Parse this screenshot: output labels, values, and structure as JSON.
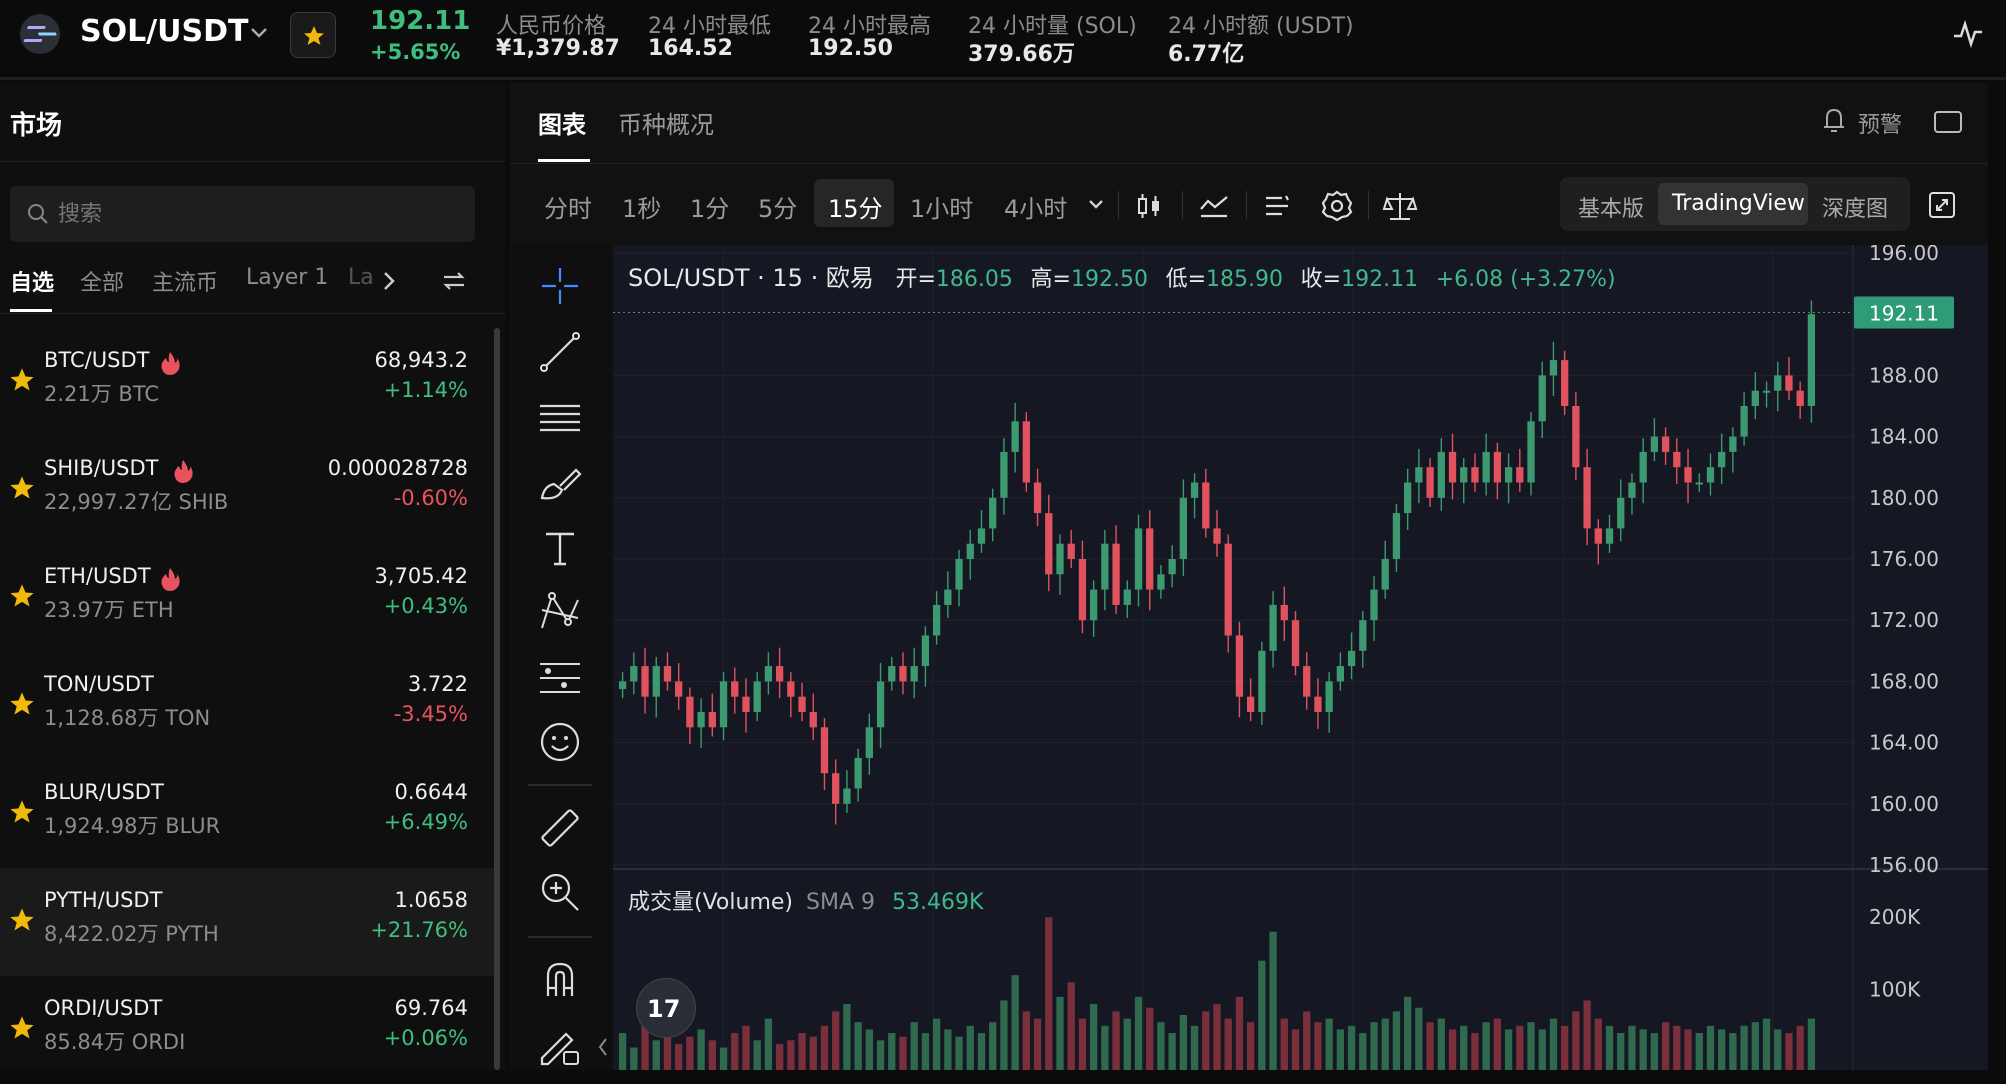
{
  "header": {
    "pair": "SOL/USDT",
    "last_price": "192.11",
    "change_pct": "+5.65%",
    "stats": [
      {
        "label": "人民币价格",
        "value": "¥1,379.87"
      },
      {
        "label": "24 小时最低",
        "value": "164.52"
      },
      {
        "label": "24 小时最高",
        "value": "192.50"
      },
      {
        "label": "24 小时量 (SOL)",
        "value": "379.66万"
      },
      {
        "label": "24 小时额 (USDT)",
        "value": "6.77亿"
      }
    ]
  },
  "sidebar": {
    "title": "市场",
    "search_placeholder": "搜索",
    "tabs": [
      "自选",
      "全部",
      "主流币",
      "Layer 1",
      "La"
    ],
    "items": [
      {
        "pair": "BTC/USDT",
        "volume": "2.21万 BTC",
        "price": "68,943.2",
        "change": "+1.14%",
        "hot": true,
        "up": true
      },
      {
        "pair": "SHIB/USDT",
        "volume": "22,997.27亿 SHIB",
        "price": "0.000028728",
        "change": "-0.60%",
        "hot": true,
        "up": false
      },
      {
        "pair": "ETH/USDT",
        "volume": "23.97万 ETH",
        "price": "3,705.42",
        "change": "+0.43%",
        "hot": true,
        "up": true
      },
      {
        "pair": "TON/USDT",
        "volume": "1,128.68万 TON",
        "price": "3.722",
        "change": "-3.45%",
        "hot": false,
        "up": false
      },
      {
        "pair": "BLUR/USDT",
        "volume": "1,924.98万 BLUR",
        "price": "0.6644",
        "change": "+6.49%",
        "hot": false,
        "up": true
      },
      {
        "pair": "PYTH/USDT",
        "volume": "8,422.02万 PYTH",
        "price": "1.0658",
        "change": "+21.76%",
        "hot": false,
        "up": true
      },
      {
        "pair": "ORDI/USDT",
        "volume": "85.84万 ORDI",
        "price": "69.764",
        "change": "+0.06%",
        "hot": false,
        "up": true
      }
    ]
  },
  "main": {
    "tabs": [
      "图表",
      "币种概况"
    ],
    "alert_label": "预警",
    "intervals": [
      "分时",
      "1秒",
      "1分",
      "5分",
      "15分",
      "1小时",
      "4小时"
    ],
    "active_interval": "15分",
    "views": [
      "基本版",
      "TradingView",
      "深度图"
    ],
    "active_view": "TradingView"
  },
  "chart_data": {
    "type": "candlestick",
    "legend": {
      "symbol": "SOL/USDT · 15 · 欧易",
      "open_label": "开=",
      "open": "186.05",
      "high_label": "高=",
      "high": "192.50",
      "low_label": "低=",
      "low": "185.90",
      "close_label": "收=",
      "close": "192.11",
      "change": "+6.08 (+3.27%)"
    },
    "price_axis_ticks": [
      "196.00",
      "188.00",
      "184.00",
      "180.00",
      "176.00",
      "172.00",
      "168.00",
      "164.00",
      "160.00",
      "156.00"
    ],
    "last_price_tag": "192.11",
    "closes": [
      168,
      169,
      167,
      169,
      168,
      167,
      165,
      166,
      165,
      168,
      167,
      166,
      168,
      169,
      168,
      167,
      166,
      165,
      162,
      160,
      161,
      163,
      165,
      168,
      169,
      168,
      169,
      171,
      173,
      174,
      176,
      177,
      178,
      180,
      183,
      185,
      181,
      179,
      175,
      177,
      176,
      172,
      174,
      177,
      173,
      174,
      178,
      174,
      175,
      176,
      180,
      181,
      178,
      177,
      171,
      167,
      166,
      170,
      173,
      172,
      169,
      167,
      166,
      168,
      169,
      170,
      172,
      174,
      176,
      179,
      181,
      182,
      180,
      183,
      181,
      182,
      181,
      183,
      181,
      182,
      181,
      185,
      188,
      189,
      186,
      182,
      178,
      177,
      178,
      180,
      181,
      183,
      184,
      183,
      182,
      181,
      181,
      182,
      183,
      184,
      186,
      187,
      187,
      188,
      187,
      186,
      192
    ],
    "volume": {
      "title": "成交量(Volume)",
      "sma_label": "SMA 9",
      "sma_value": "53.469K",
      "axis_ticks": [
        "200K",
        "100K"
      ],
      "values": [
        40,
        20,
        55,
        30,
        60,
        25,
        35,
        45,
        30,
        20,
        40,
        50,
        30,
        60,
        25,
        30,
        40,
        35,
        50,
        70,
        80,
        55,
        45,
        30,
        40,
        35,
        55,
        40,
        60,
        45,
        35,
        50,
        40,
        55,
        85,
        120,
        70,
        60,
        200,
        90,
        110,
        60,
        80,
        50,
        70,
        60,
        90,
        75,
        55,
        40,
        65,
        50,
        70,
        80,
        60,
        90,
        55,
        140,
        180,
        60,
        45,
        70,
        55,
        60,
        45,
        50,
        40,
        55,
        60,
        70,
        90,
        75,
        55,
        60,
        45,
        50,
        40,
        55,
        60,
        45,
        50,
        55,
        45,
        60,
        50,
        70,
        85,
        60,
        50,
        40,
        50,
        45,
        40,
        55,
        50,
        45,
        40,
        50,
        45,
        40,
        50,
        55,
        60,
        45,
        40,
        50,
        60
      ]
    }
  }
}
